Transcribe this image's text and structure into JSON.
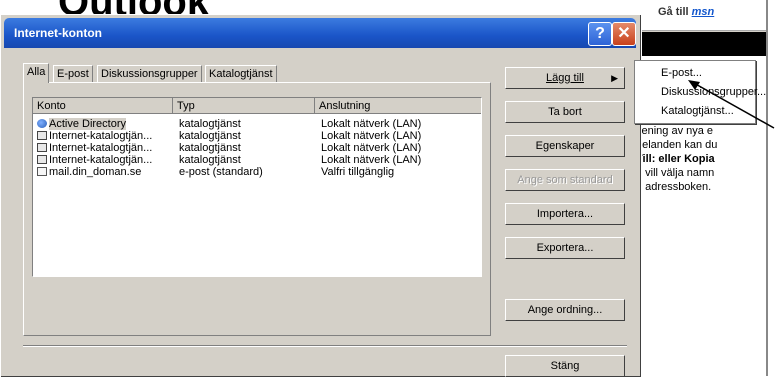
{
  "background": {
    "heading_fragment": "Outlook"
  },
  "right_strip": {
    "goto_label": "Gå till",
    "goto_brand": "msn",
    "text_lines": [
      "sening av nya e",
      "delanden kan du",
      "Till: eller Kopia",
      "u vill välja namn",
      "n adressboken."
    ]
  },
  "dialog": {
    "title": "Internet-konton",
    "help_label": "?",
    "close_label": "✕",
    "tabs": [
      "Alla",
      "E-post",
      "Diskussionsgrupper",
      "Katalogtjänst"
    ],
    "columns": [
      "Konto",
      "Typ",
      "Anslutning"
    ],
    "rows": [
      {
        "icon": "ico-ad",
        "account": "Active Directory",
        "type": "katalogtjänst",
        "connection": "Lokalt nätverk (LAN)"
      },
      {
        "icon": "ico-dir",
        "account": "Internet-katalogtjän...",
        "type": "katalogtjänst",
        "connection": "Lokalt nätverk (LAN)"
      },
      {
        "icon": "ico-dir",
        "account": "Internet-katalogtjän...",
        "type": "katalogtjänst",
        "connection": "Lokalt nätverk (LAN)"
      },
      {
        "icon": "ico-dir",
        "account": "Internet-katalogtjän...",
        "type": "katalogtjänst",
        "connection": "Lokalt nätverk (LAN)"
      },
      {
        "icon": "ico-mail",
        "account": "mail.din_doman.se",
        "type": "e-post (standard)",
        "connection": "Valfri tillgänglig"
      }
    ],
    "buttons": {
      "add": "Lägg till",
      "remove": "Ta bort",
      "properties": "Egenskaper",
      "set_default": "Ange som standard",
      "import": "Importera...",
      "export": "Exportera...",
      "order": "Ange ordning...",
      "close": "Stäng"
    }
  },
  "add_menu": {
    "items": [
      "E-post...",
      "Diskussionsgrupper...",
      "Katalogtjänst..."
    ]
  }
}
